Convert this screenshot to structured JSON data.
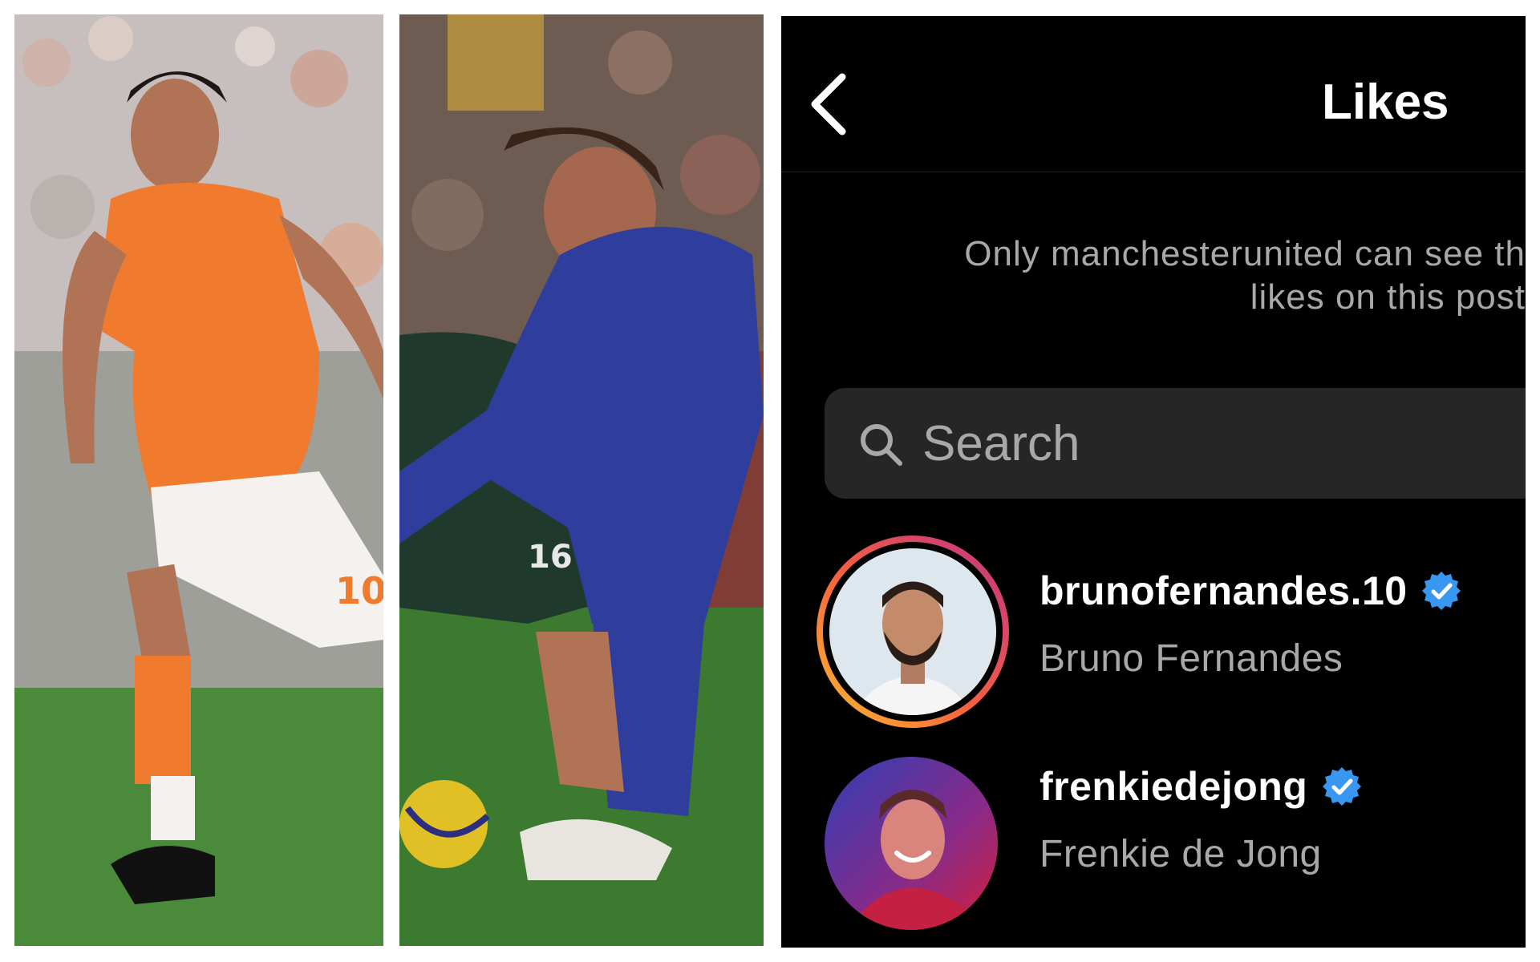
{
  "header": {
    "title": "Likes",
    "back_icon": "chevron-left-icon"
  },
  "notice": {
    "line1": "Only manchesterunited can see th",
    "line2": "likes on this post"
  },
  "search": {
    "placeholder": "Search",
    "icon": "search-icon"
  },
  "likes": [
    {
      "username": "brunofernandes.10",
      "full_name": "Bruno Fernandes",
      "verified": true,
      "has_story_ring": true
    },
    {
      "username": "frenkiedejong",
      "full_name": "Frenkie de Jong",
      "verified": true,
      "has_story_ring": false
    }
  ],
  "colors": {
    "background": "#000000",
    "secondary_text": "#a8a8a8",
    "search_field": "#262626",
    "verified_badge": "#3897f0",
    "story_ring_start": "#fdbb2d",
    "story_ring_end": "#e1306c"
  },
  "photos": [
    {
      "subject": "footballer-orange-kit",
      "number": "10"
    },
    {
      "subject": "footballer-blue-kit",
      "number": "16"
    }
  ]
}
